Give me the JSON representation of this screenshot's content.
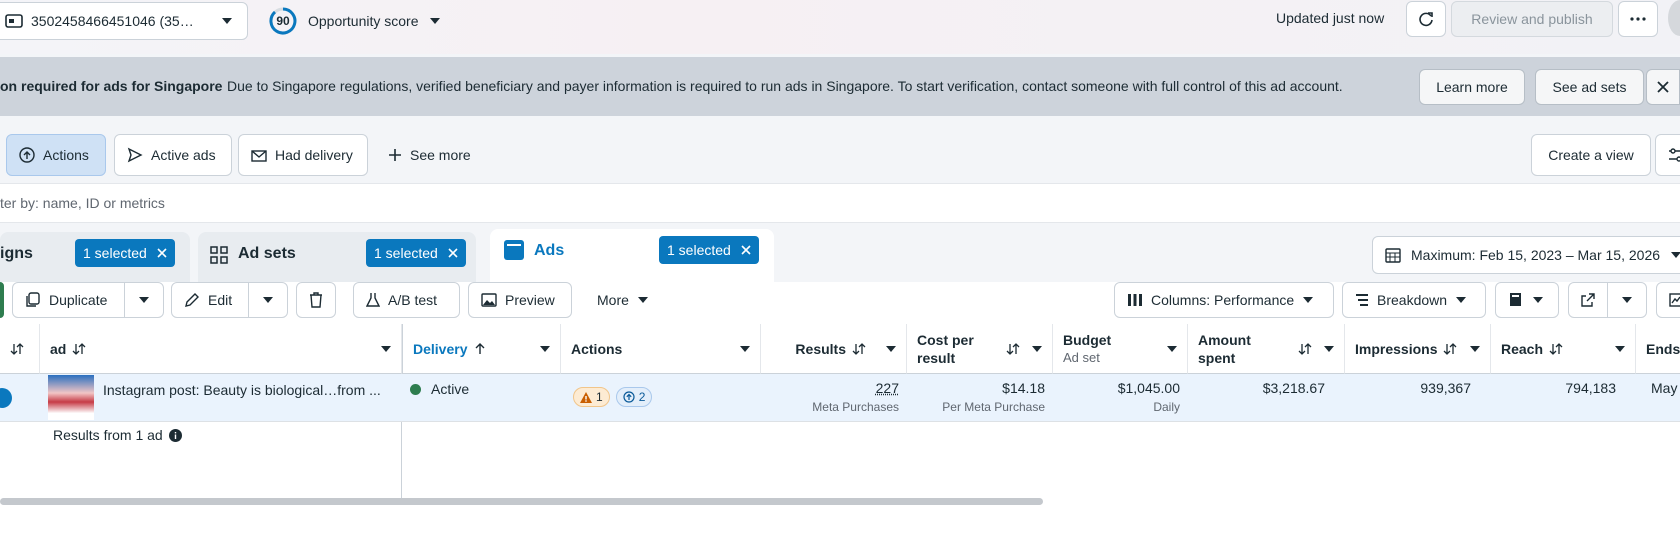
{
  "topbar": {
    "account": "3502458466451046 (35…",
    "score_value": "90",
    "score_label": "Opportunity score",
    "updated": "Updated just now",
    "review_publish": "Review and publish"
  },
  "banner": {
    "title": "on required for ads for Singapore",
    "text": "Due to Singapore regulations, verified beneficiary and payer information is required to run ads in Singapore. To start verification, contact someone with full control of this ad account.",
    "learn_more": "Learn more",
    "see_ad_sets": "See ad sets"
  },
  "chips": {
    "actions": "Actions",
    "active_ads": "Active ads",
    "had_delivery": "Had delivery",
    "see_more": "See more",
    "create_view": "Create a view"
  },
  "search": {
    "placeholder": "ter by: name, ID or metrics"
  },
  "tabs": {
    "campaigns": "igns",
    "ad_sets": "Ad sets",
    "ads": "Ads",
    "selected": "1 selected",
    "date_range": "Maximum: Feb 15, 2023 – Mar 15, 2026"
  },
  "toolbar": {
    "duplicate": "Duplicate",
    "edit": "Edit",
    "ab_test": "A/B test",
    "preview": "Preview",
    "more": "More",
    "columns": "Columns: Performance",
    "breakdown": "Breakdown"
  },
  "table": {
    "headers": {
      "ad": "ad",
      "delivery": "Delivery",
      "actions": "Actions",
      "results": "Results",
      "cost_per_result_1": "Cost per",
      "cost_per_result_2": "result",
      "budget": "Budget",
      "budget_sub": "Ad set",
      "amount_spent_1": "Amount",
      "amount_spent_2": "spent",
      "impressions": "Impressions",
      "reach": "Reach",
      "ends": "Ends"
    },
    "row": {
      "name": "Instagram post: Beauty is biological…from ...",
      "delivery": "Active",
      "warn_count": "1",
      "action_count": "2",
      "results": "227",
      "results_sub": "Meta Purchases",
      "cost": "$14.18",
      "cost_sub": "Per Meta Purchase",
      "budget": "$1,045.00",
      "budget_sub": "Daily",
      "spent": "$3,218.67",
      "impressions": "939,367",
      "reach": "794,183",
      "ends": "May"
    },
    "footer": "Results from 1 ad"
  },
  "colors": {
    "accent": "#0a78be",
    "active_green": "#2e7d4f"
  }
}
